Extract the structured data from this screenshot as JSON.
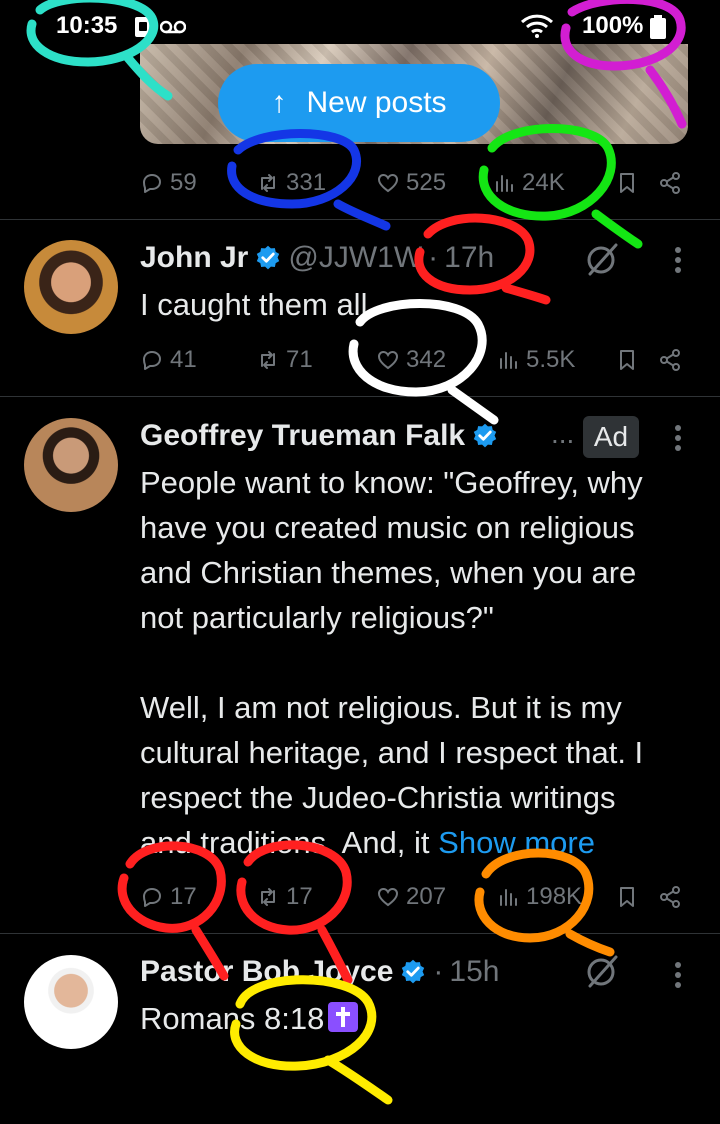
{
  "status_bar": {
    "time": "10:35",
    "battery": "100%"
  },
  "banner": {
    "new_posts_label": "New posts"
  },
  "tweets": [
    {
      "stats": {
        "replies": "59",
        "reposts": "331",
        "likes": "525",
        "views": "24K"
      }
    },
    {
      "name": "John Jr",
      "handle": "@JJW1W",
      "dot": "·",
      "age": "17h",
      "text": "I caught them all",
      "stats": {
        "replies": "41",
        "reposts": "71",
        "likes": "342",
        "views": "5.5K"
      }
    },
    {
      "name": "Geoffrey Trueman Falk",
      "ellipsis": "...",
      "ad": "Ad",
      "lines": [
        "People want to know: \"Geoffrey, why",
        "have you created music on religious",
        "and Christian themes, when you are",
        "not particularly religious?\"",
        "",
        "Well, I am not religious. But it is my",
        "cultural heritage, and I respect that. I",
        "respect the Judeo-Christia writings",
        "and traditions. And, it"
      ],
      "show_more": "Show more",
      "stats": {
        "replies": "17",
        "reposts": "17",
        "likes": "207",
        "views": "198K"
      }
    },
    {
      "name": "Pastor Bob Joyce",
      "dot": "·",
      "age": "15h",
      "text": "Romans 8:18"
    }
  ],
  "colors": {
    "accent": "#1d9bf0",
    "muted": "#71767b",
    "annotation_cyan": "#2de0c8",
    "annotation_magenta": "#d21ed2",
    "annotation_blue": "#1436e6",
    "annotation_green": "#14e614",
    "annotation_red": "#ff2020",
    "annotation_white": "#ffffff",
    "annotation_orange": "#ff8c00",
    "annotation_yellow": "#ffec00"
  }
}
